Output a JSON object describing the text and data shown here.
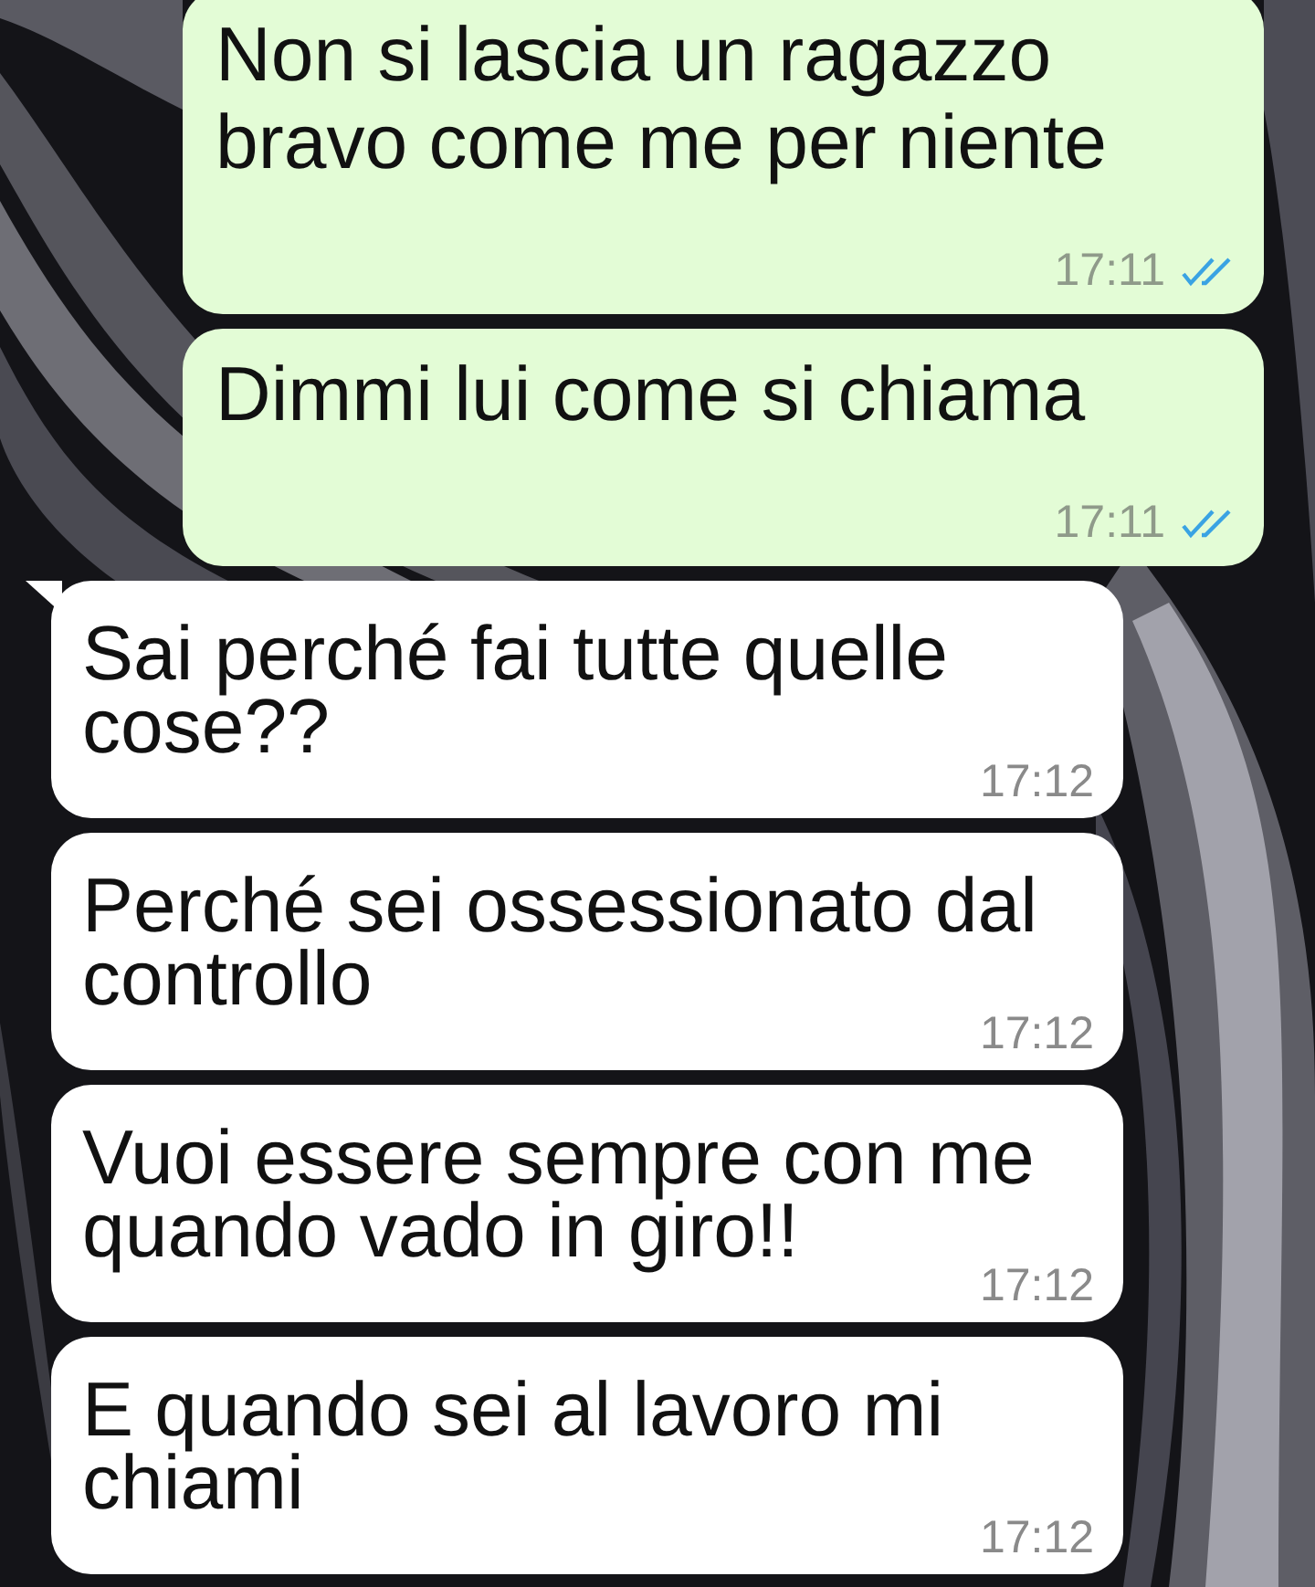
{
  "messages": [
    {
      "kind": "outgoing",
      "text": "Non si lascia un ragazzo bravo come me per niente",
      "time": "17:11",
      "read": true,
      "tail": false
    },
    {
      "kind": "outgoing",
      "text": "Dimmi lui come si chiama",
      "time": "17:11",
      "read": true,
      "tail": false
    },
    {
      "kind": "incoming",
      "text": "Sai perché fai tutte quelle cose??",
      "time": "17:12",
      "tail": true
    },
    {
      "kind": "incoming",
      "text": "Perché sei ossessionato dal controllo",
      "time": "17:12",
      "tail": false
    },
    {
      "kind": "incoming",
      "text": "Vuoi essere sempre con me quando vado in giro!!",
      "time": "17:12",
      "tail": false
    },
    {
      "kind": "incoming",
      "text": "E quando sei al lavoro mi chiami",
      "time": "17:12",
      "tail": false
    }
  ]
}
